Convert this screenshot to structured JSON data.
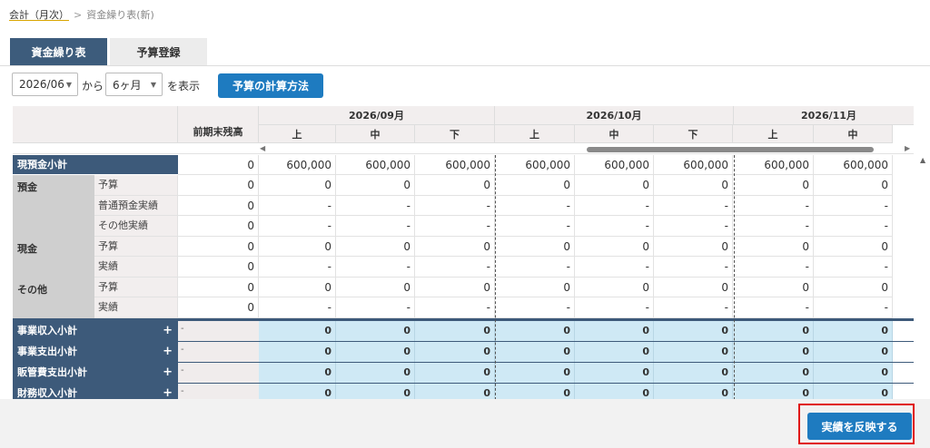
{
  "breadcrumb": {
    "link": "会計（月次）",
    "separator": ">",
    "current": "資金繰り表(新)"
  },
  "tabs": [
    {
      "label": "資金繰り表",
      "active": true
    },
    {
      "label": "予算登録",
      "active": false
    }
  ],
  "controls": {
    "from_month": "2026/06",
    "from_suffix": "から",
    "period": "6ヶ月",
    "period_suffix": "を表示",
    "calc_button": "予算の計算方法"
  },
  "table": {
    "months": [
      "2026/09月",
      "2026/10月",
      "2026/11月"
    ],
    "prev_balance_header": "前期末残高",
    "periods": [
      "上",
      "中",
      "下",
      "上",
      "中",
      "下",
      "上",
      "中"
    ],
    "cash_subtotal": {
      "label": "現預金小計",
      "prev": "0",
      "values": [
        "600,000",
        "600,000",
        "600,000",
        "600,000",
        "600,000",
        "600,000",
        "600,000",
        "600,000"
      ]
    },
    "groups": [
      {
        "label": "預金",
        "rows": [
          {
            "label": "予算",
            "prev": "0",
            "values": [
              "0",
              "0",
              "0",
              "0",
              "0",
              "0",
              "0",
              "0"
            ]
          },
          {
            "label": "普通預金実績",
            "prev": "0",
            "values": [
              "-",
              "-",
              "-",
              "-",
              "-",
              "-",
              "-",
              "-"
            ]
          },
          {
            "label": "その他実績",
            "prev": "0",
            "values": [
              "-",
              "-",
              "-",
              "-",
              "-",
              "-",
              "-",
              "-"
            ]
          }
        ]
      },
      {
        "label": "現金",
        "rows": [
          {
            "label": "予算",
            "prev": "0",
            "values": [
              "0",
              "0",
              "0",
              "0",
              "0",
              "0",
              "0",
              "0"
            ]
          },
          {
            "label": "実績",
            "prev": "0",
            "values": [
              "-",
              "-",
              "-",
              "-",
              "-",
              "-",
              "-",
              "-"
            ]
          }
        ]
      },
      {
        "label": "その他",
        "rows": [
          {
            "label": "予算",
            "prev": "0",
            "values": [
              "0",
              "0",
              "0",
              "0",
              "0",
              "0",
              "0",
              "0"
            ]
          },
          {
            "label": "実績",
            "prev": "0",
            "values": [
              "-",
              "-",
              "-",
              "-",
              "-",
              "-",
              "-",
              "-"
            ]
          }
        ]
      }
    ],
    "summaries": [
      {
        "label": "事業収入小計",
        "first": "-",
        "values": [
          "0",
          "0",
          "0",
          "0",
          "0",
          "0",
          "0",
          "0"
        ]
      },
      {
        "label": "事業支出小計",
        "first": "-",
        "values": [
          "0",
          "0",
          "0",
          "0",
          "0",
          "0",
          "0",
          "0"
        ]
      },
      {
        "label": "販管費支出小計",
        "first": "-",
        "values": [
          "0",
          "0",
          "0",
          "0",
          "0",
          "0",
          "0",
          "0"
        ]
      },
      {
        "label": "財務収入小計",
        "first": "-",
        "values": [
          "0",
          "0",
          "0",
          "0",
          "0",
          "0",
          "0",
          "0"
        ]
      }
    ],
    "expand_icon": "plus-icon"
  },
  "footer": {
    "reflect_button": "実績を反映する"
  },
  "colors": {
    "header_dark": "#3d5a7a",
    "accent_blue": "#1e7bc0",
    "summary_blue": "#cfe9f5",
    "highlight_red": "#e01010"
  }
}
